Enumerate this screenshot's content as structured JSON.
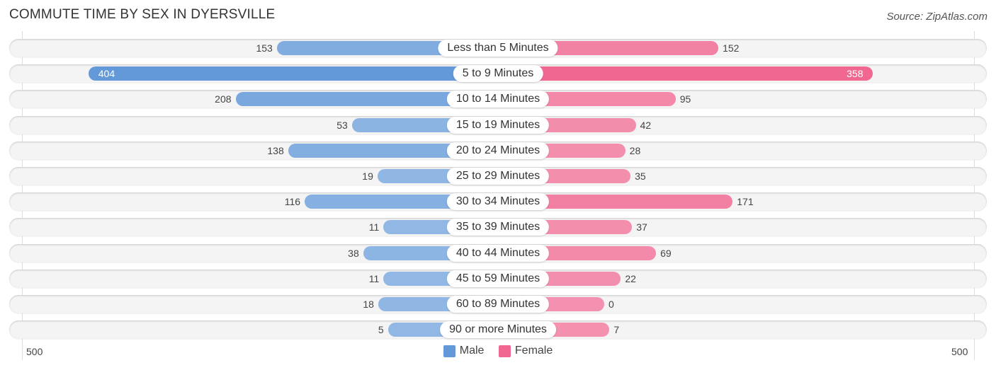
{
  "header": {
    "title": "COMMUTE TIME BY SEX IN DYERSVILLE",
    "source": "Source: ZipAtlas.com"
  },
  "colors": {
    "male_strong": "#6399d8",
    "male_light": "#a6c6ea",
    "female_strong": "#f06890",
    "female_light": "#f5a3bd",
    "row_bg": "#f4f4f4"
  },
  "chart_data": {
    "type": "bar",
    "orientation": "horizontal-diverging",
    "title": "COMMUTE TIME BY SEX IN DYERSVILLE",
    "categories": [
      "Less than 5 Minutes",
      "5 to 9 Minutes",
      "10 to 14 Minutes",
      "15 to 19 Minutes",
      "20 to 24 Minutes",
      "25 to 29 Minutes",
      "30 to 34 Minutes",
      "35 to 39 Minutes",
      "40 to 44 Minutes",
      "45 to 59 Minutes",
      "60 to 89 Minutes",
      "90 or more Minutes"
    ],
    "series": [
      {
        "name": "Male",
        "side": "left",
        "values": [
          153,
          404,
          208,
          53,
          138,
          19,
          116,
          11,
          38,
          11,
          18,
          5
        ]
      },
      {
        "name": "Female",
        "side": "right",
        "values": [
          152,
          358,
          95,
          42,
          28,
          35,
          171,
          37,
          69,
          22,
          0,
          7
        ]
      }
    ],
    "axis": {
      "min_label": "500",
      "max_label": "500",
      "range": [
        -500,
        500
      ]
    },
    "legend": {
      "position": "bottom-center",
      "entries": [
        "Male",
        "Female"
      ]
    },
    "grid": false
  }
}
